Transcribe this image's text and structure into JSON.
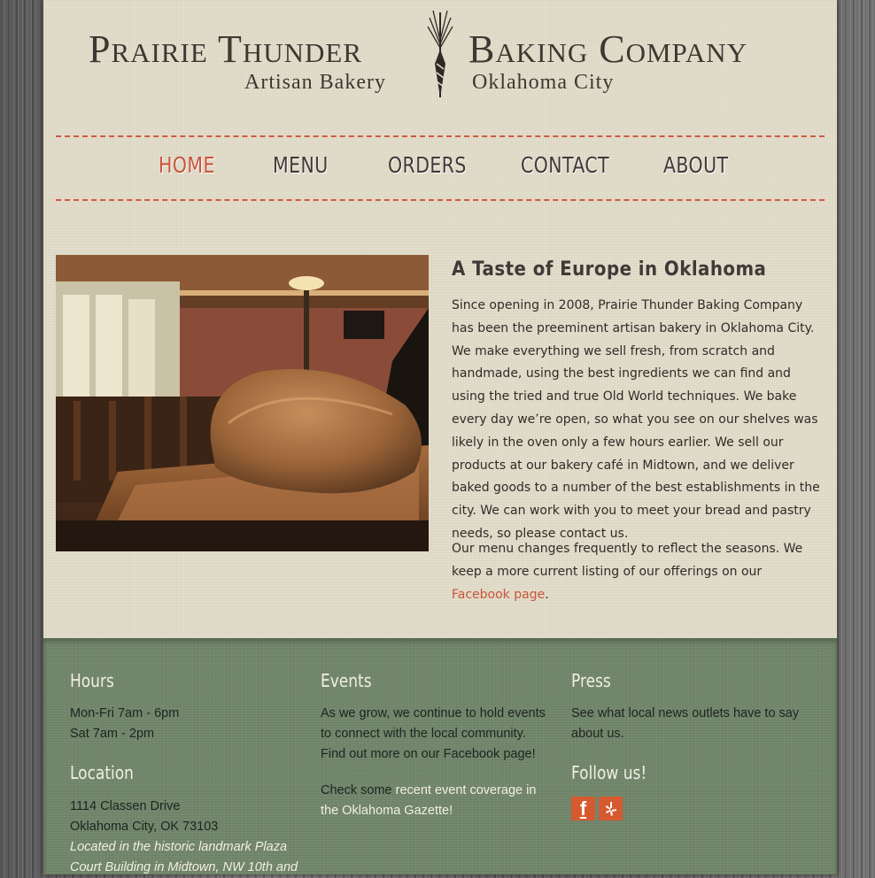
{
  "header": {
    "logo_line1_left": "Prairie Thunder",
    "logo_line1_right": "Baking Company",
    "logo_line2_left": "Artisan Bakery",
    "logo_line2_right": "Oklahoma City"
  },
  "nav": {
    "items": [
      {
        "label": "HOME",
        "active": true
      },
      {
        "label": "MENU"
      },
      {
        "label": "ORDERS"
      },
      {
        "label": "CONTACT"
      },
      {
        "label": "ABOUT"
      }
    ]
  },
  "intro": {
    "title": "A Taste of Europe in Oklahoma",
    "paragraph1": "Since opening in 2008, Prairie Thunder Baking Company has been the preeminent artisan bakery in Oklahoma City. We make everything we sell fresh, from scratch and handmade, using the best ingredients we can find and using the tried and true Old World techniques. We bake every day we’re open, so what you see on our shelves was likely in the oven only a few hours earlier. We sell our products at our bakery café in Midtown, and we deliver baked goods to a number of the best establishments in the city. We can work with you to meet your bread and pastry needs, so please contact us.",
    "paragraph2_before": "Our menu changes frequently to reflect the seasons. We keep a more current listing of our offerings on our ",
    "paragraph2_link": "Facebook page",
    "paragraph2_after": "."
  },
  "footer": {
    "hours": {
      "heading": "Hours",
      "line1": "Mon-Fri 7am - 6pm",
      "line2": "Sat 7am - 2pm"
    },
    "location": {
      "heading": "Location",
      "line1": "1114 Classen Drive",
      "line2": "Oklahoma City, OK 73103",
      "note_line1": "Located in the historic landmark Plaza",
      "note_line2": "Court Building in Midtown, NW 10th and"
    },
    "events": {
      "heading": "Events",
      "text": "As we grow, we continue to hold events to connect with the local community. Find out more on our Facebook page!",
      "check_before": "Check some ",
      "check_link": "recent event coverage in the Oklahoma Gazette!"
    },
    "press": {
      "heading": "Press",
      "text": "See what local news outlets have to say about us."
    },
    "follow": {
      "heading": "Follow us!",
      "facebook_icon": "facebook-icon",
      "yelp_icon": "yelp-icon"
    }
  },
  "colors": {
    "accent": "#c9553b",
    "footer_bg": "#72876c",
    "page_bg": "#e3ddcb"
  }
}
